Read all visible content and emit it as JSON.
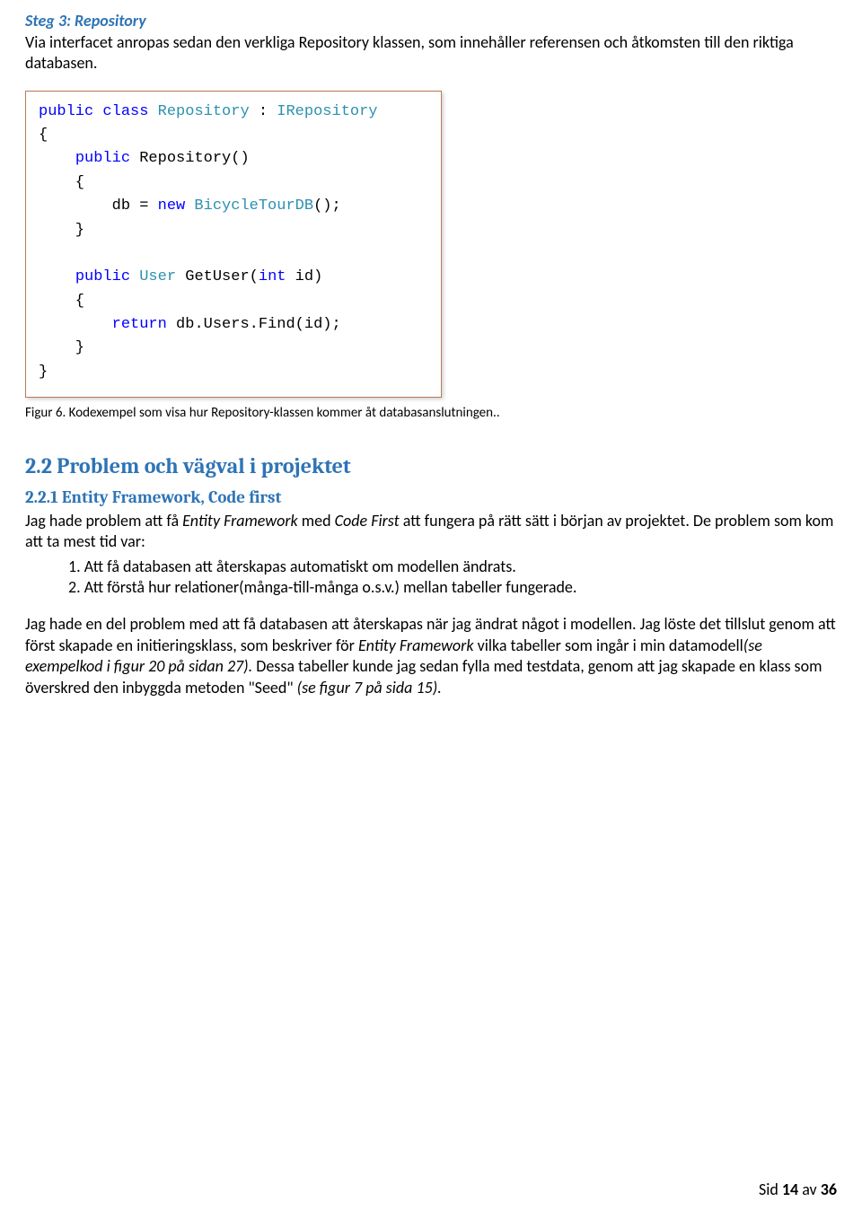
{
  "step_heading": "Steg 3: Repository",
  "step_desc": "Via interfacet anropas sedan den verkliga Repository klassen, som innehåller referensen och åtkomsten till den riktiga databasen.",
  "code": {
    "l1_kw1": "public",
    "l1_kw2": "class",
    "l1_typ1": "Repository",
    "l1_txt1": " : ",
    "l1_typ2": "IRepository",
    "l2": "{",
    "l3_kw1": "public",
    "l3_txt1": " Repository()",
    "l4": "    {",
    "l5_txt1": "        db = ",
    "l5_kw1": "new",
    "l5_typ1": " BicycleTourDB",
    "l5_txt2": "();",
    "l6": "    }",
    "l7_kw1": "public",
    "l7_typ1": " User",
    "l7_txt1": " GetUser(",
    "l7_kw2": "int",
    "l7_txt2": " id)",
    "l8": "    {",
    "l9_kw1": "return",
    "l9_txt1": " db.Users.Find(id);",
    "l10": "    }",
    "l11": "}"
  },
  "fig_caption": "Figur 6. Kodexempel som visa hur Repository-klassen kommer åt databasanslutningen..",
  "sec_h2": "2.2 Problem och vägval i projektet",
  "sec_h3": "2.2.1 Entity Framework, Code first",
  "sub_intro_a": "Jag hade problem att få ",
  "sub_intro_i1": "Entity Framework",
  "sub_intro_b": " med ",
  "sub_intro_i2": "Code First",
  "sub_intro_c": " att fungera på rätt sätt i början av projektet. De problem som kom att ta mest tid var:",
  "list_item_1": "1.    Att få databasen att återskapas automatiskt om modellen ändrats.",
  "list_item_2": "2.    Att förstå hur relationer(många-till-många o.s.v.) mellan tabeller fungerade.",
  "para2_a": "Jag hade en del problem med att få databasen att återskapas när jag ändrat något i modellen. Jag löste det tillslut genom att först skapade en initieringsklass, som beskriver för ",
  "para2_i1": "Entity Framework",
  "para2_b": " vilka tabeller som ingår i min datamodell",
  "para2_i2": "(se exempelkod i figur 20 på sidan 27).",
  "para2_c": " Dessa tabeller kunde jag sedan fylla med testdata, genom att jag skapade en klass som överskred den inbyggda metoden \"Seed\" ",
  "para2_i3": "(se figur 7 på sida 15).",
  "footer_a": "Sid ",
  "footer_page": "14",
  "footer_b": " av ",
  "footer_total": "36"
}
